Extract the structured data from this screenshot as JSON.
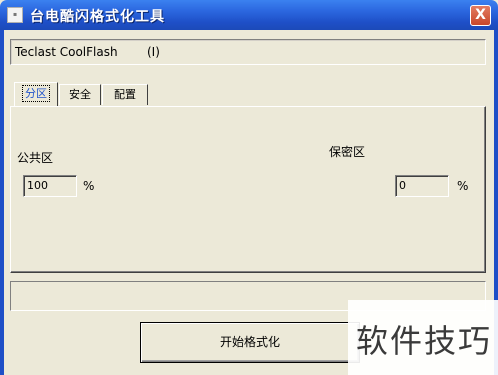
{
  "window": {
    "title": "台电酷闪格式化工具",
    "close_label": "X"
  },
  "device": {
    "name": "Teclast CoolFlash",
    "drive": "(I)"
  },
  "tabs": [
    {
      "label": "分区",
      "active": true
    },
    {
      "label": "安全",
      "active": false
    },
    {
      "label": "配置",
      "active": false
    }
  ],
  "partition": {
    "public": {
      "label": "公共区",
      "value": "100",
      "unit": "%"
    },
    "secure": {
      "label": "保密区",
      "value": "0",
      "unit": "%"
    }
  },
  "status": {
    "text": ""
  },
  "actions": {
    "start_label": "开始格式化"
  },
  "watermark": {
    "text": "软件技巧"
  },
  "colors": {
    "titlebar": "#2C68E0",
    "background": "#ECE9D8",
    "active_tab_text": "#2255CC"
  }
}
